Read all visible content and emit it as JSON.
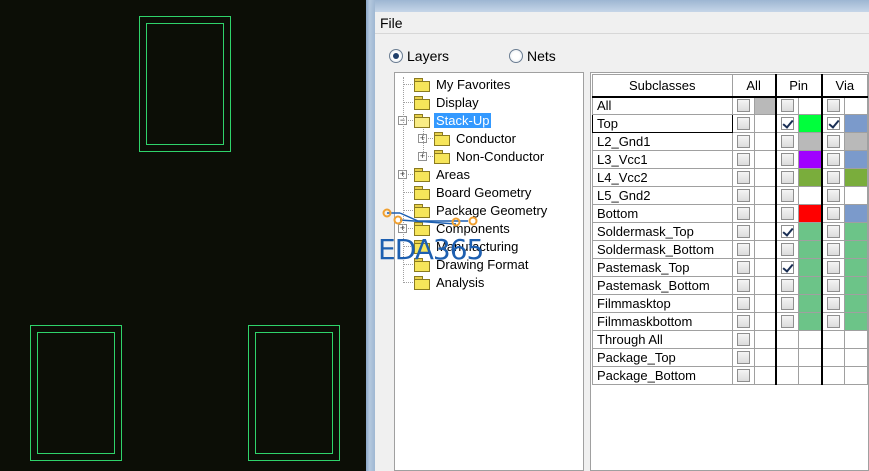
{
  "menu": {
    "file": "File"
  },
  "view_mode": {
    "layers_label": "Layers",
    "nets_label": "Nets",
    "selected": "Layers"
  },
  "tree": [
    {
      "label": "My Favorites",
      "level": 0,
      "expander": "",
      "selected": false,
      "open": false
    },
    {
      "label": "Display",
      "level": 0,
      "expander": "",
      "selected": false,
      "open": false
    },
    {
      "label": "Stack-Up",
      "level": 0,
      "expander": "−",
      "selected": true,
      "open": true
    },
    {
      "label": "Conductor",
      "level": 1,
      "expander": "+",
      "selected": false,
      "open": false
    },
    {
      "label": "Non-Conductor",
      "level": 1,
      "expander": "+",
      "selected": false,
      "open": false
    },
    {
      "label": "Areas",
      "level": 0,
      "expander": "+",
      "selected": false,
      "open": false
    },
    {
      "label": "Board Geometry",
      "level": 0,
      "expander": "",
      "selected": false,
      "open": false
    },
    {
      "label": "Package Geometry",
      "level": 0,
      "expander": "",
      "selected": false,
      "open": false
    },
    {
      "label": "Components",
      "level": 0,
      "expander": "+",
      "selected": false,
      "open": false
    },
    {
      "label": "Manufacturing",
      "level": 0,
      "expander": "",
      "selected": false,
      "open": false
    },
    {
      "label": "Drawing Format",
      "level": 0,
      "expander": "",
      "selected": false,
      "open": false
    },
    {
      "label": "Analysis",
      "level": 0,
      "expander": "",
      "selected": false,
      "open": false
    }
  ],
  "grid": {
    "headers": {
      "subclasses": "Subclasses",
      "all": "All",
      "pin": "Pin",
      "via": "Via"
    },
    "rows": [
      {
        "name": "All",
        "all": false,
        "all_color": "#b9b9b9",
        "pin": false,
        "pin_color": "",
        "via": false,
        "via_color": "",
        "has_pin": true,
        "has_via": true
      },
      {
        "name": "Top",
        "all": false,
        "all_color": "",
        "pin": true,
        "pin_color": "#00ff3c",
        "via": true,
        "via_color": "#7b9acb",
        "has_pin": true,
        "has_via": true,
        "selected": true
      },
      {
        "name": "L2_Gnd1",
        "all": false,
        "all_color": "",
        "pin": false,
        "pin_color": "#b9b9b9",
        "via": false,
        "via_color": "#b9b9b9",
        "has_pin": true,
        "has_via": true
      },
      {
        "name": "L3_Vcc1",
        "all": false,
        "all_color": "",
        "pin": false,
        "pin_color": "#a000ff",
        "via": false,
        "via_color": "#7b9acb",
        "has_pin": true,
        "has_via": true
      },
      {
        "name": "L4_Vcc2",
        "all": false,
        "all_color": "",
        "pin": false,
        "pin_color": "#7aad3c",
        "via": false,
        "via_color": "#7aad3c",
        "has_pin": true,
        "has_via": true
      },
      {
        "name": "L5_Gnd2",
        "all": false,
        "all_color": "",
        "pin": false,
        "pin_color": "",
        "via": false,
        "via_color": "",
        "has_pin": true,
        "has_via": true
      },
      {
        "name": "Bottom",
        "all": false,
        "all_color": "",
        "pin": false,
        "pin_color": "#ff0000",
        "via": false,
        "via_color": "#7b9acb",
        "has_pin": true,
        "has_via": true
      },
      {
        "name": "Soldermask_Top",
        "all": false,
        "all_color": "",
        "pin": true,
        "pin_color": "#6cc488",
        "via": false,
        "via_color": "#6cc488",
        "has_pin": true,
        "has_via": true
      },
      {
        "name": "Soldermask_Bottom",
        "all": false,
        "all_color": "",
        "pin": false,
        "pin_color": "#6cc488",
        "via": false,
        "via_color": "#6cc488",
        "has_pin": true,
        "has_via": true
      },
      {
        "name": "Pastemask_Top",
        "all": false,
        "all_color": "",
        "pin": true,
        "pin_color": "#6cc488",
        "via": false,
        "via_color": "#6cc488",
        "has_pin": true,
        "has_via": true
      },
      {
        "name": "Pastemask_Bottom",
        "all": false,
        "all_color": "",
        "pin": false,
        "pin_color": "#6cc488",
        "via": false,
        "via_color": "#6cc488",
        "has_pin": true,
        "has_via": true
      },
      {
        "name": "Filmmasktop",
        "all": false,
        "all_color": "",
        "pin": false,
        "pin_color": "#6cc488",
        "via": false,
        "via_color": "#6cc488",
        "has_pin": true,
        "has_via": true
      },
      {
        "name": "Filmmaskbottom",
        "all": false,
        "all_color": "",
        "pin": false,
        "pin_color": "#6cc488",
        "via": false,
        "via_color": "#6cc488",
        "has_pin": true,
        "has_via": true
      },
      {
        "name": "Through All",
        "all": false,
        "all_color": "",
        "has_pin": false,
        "has_via": false
      },
      {
        "name": "Package_Top",
        "all": false,
        "all_color": "",
        "has_pin": false,
        "has_via": false
      },
      {
        "name": "Package_Bottom",
        "all": false,
        "all_color": "",
        "has_pin": false,
        "has_via": false
      }
    ]
  },
  "watermark": {
    "text": "EDA365"
  },
  "colors": {
    "pad_outline": "#2fd36a",
    "canvas_bg": "#0c0e06",
    "selection": "#3399ff"
  },
  "icons": [
    "folder-icon",
    "expand-icon",
    "collapse-icon",
    "checkbox-icon",
    "radio-icon"
  ]
}
